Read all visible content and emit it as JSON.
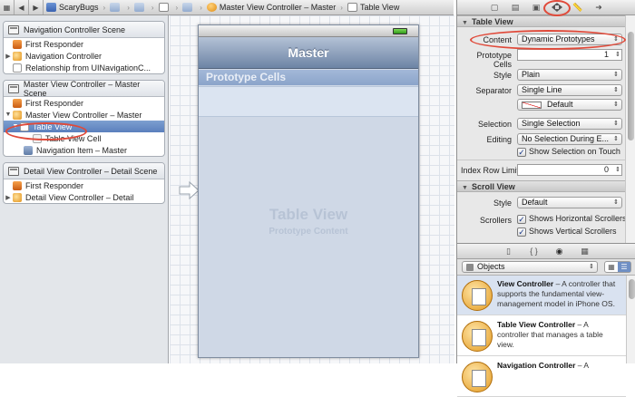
{
  "jumpbar": {
    "project": "ScaryBugs",
    "file_label": "Master View Controller – Master",
    "item_label": "Table View"
  },
  "outline": {
    "scenes": [
      {
        "title": "Navigation Controller Scene",
        "items": [
          {
            "label": "First Responder",
            "icon": "first-responder-icon"
          },
          {
            "label": "Navigation Controller",
            "icon": "view-controller-icon"
          },
          {
            "label": "Relationship from UINavigationC...",
            "icon": "relationship-icon"
          }
        ]
      },
      {
        "title": "Master View Controller – Master Scene",
        "items": [
          {
            "label": "First Responder",
            "icon": "first-responder-icon"
          },
          {
            "label": "Master View Controller – Master",
            "icon": "view-controller-icon"
          },
          {
            "label": "Table View",
            "icon": "table-view-icon"
          },
          {
            "label": "Table View Cell",
            "icon": "table-cell-icon"
          },
          {
            "label": "Navigation Item – Master",
            "icon": "navigation-item-icon"
          }
        ]
      },
      {
        "title": "Detail View Controller – Detail Scene",
        "items": [
          {
            "label": "First Responder",
            "icon": "first-responder-icon"
          },
          {
            "label": "Detail View Controller – Detail",
            "icon": "view-controller-icon"
          }
        ]
      }
    ]
  },
  "canvas": {
    "nav_title": "Master",
    "prototype_header": "Prototype Cells",
    "table_view_title": "Table View",
    "table_view_subtitle": "Prototype Content"
  },
  "inspector": {
    "table_view_section": "Table View",
    "content_label": "Content",
    "content_value": "Dynamic Prototypes",
    "prototype_cells_label": "Prototype Cells",
    "prototype_cells_value": "1",
    "style_label": "Style",
    "style_value": "Plain",
    "separator_label": "Separator",
    "separator_value": "Single Line",
    "separator_color_value": "Default",
    "selection_label": "Selection",
    "selection_value": "Single Selection",
    "editing_label": "Editing",
    "editing_value": "No Selection During E...",
    "show_selection_on_touch": "Show Selection on Touch",
    "index_row_limit_label": "Index Row Limit",
    "index_row_limit_value": "0",
    "scroll_view_section": "Scroll View",
    "scroll_style_label": "Style",
    "scroll_style_value": "Default",
    "scrollers_label": "Scrollers",
    "show_horizontal": "Shows Horizontal Scrollers",
    "show_vertical": "Shows Vertical Scrollers"
  },
  "library": {
    "filter_value": "Objects",
    "items": [
      {
        "title": "View Controller",
        "desc": " – A controller that supports the fundamental view-management model in iPhone OS."
      },
      {
        "title": "Table View Controller",
        "desc": " – A controller that manages a table view."
      },
      {
        "title": "Navigation Controller",
        "desc": " – A"
      }
    ]
  },
  "colors": {
    "highlight_ring": "#e04a3a",
    "selection": "#5a7fbd"
  }
}
